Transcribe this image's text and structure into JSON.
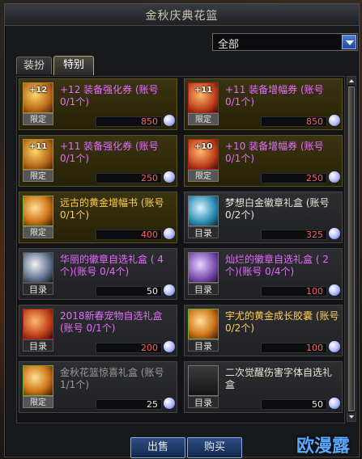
{
  "window": {
    "title": "金秋庆典花篮"
  },
  "filter": {
    "selected": "全部"
  },
  "tabs": [
    {
      "label": "装扮"
    },
    {
      "label": "特别"
    }
  ],
  "items": [
    {
      "badge": "+12",
      "tag": "限定",
      "name": "+12 装备强化券 (账号 0/1个)",
      "price": "850",
      "icon": "enhance-ticket-icon"
    },
    {
      "badge": "+11",
      "tag": "限定",
      "name": "+11 装备增幅券 (账号 0/1个)",
      "price": "850",
      "icon": "amplify-ticket-icon"
    },
    {
      "badge": "+11",
      "tag": "限定",
      "name": "+11 装备强化券 (账号 0/1个)",
      "price": "250",
      "icon": "enhance-ticket-icon"
    },
    {
      "badge": "+10",
      "tag": "限定",
      "name": "+10 装备增幅券 (账号 0/1个)",
      "price": "250",
      "icon": "amplify-ticket-icon"
    },
    {
      "badge": "",
      "tag": "限定",
      "name": "远古的黄金增幅书 (账号 0/1个)",
      "price": "400",
      "icon": "gold-book-icon"
    },
    {
      "badge": "",
      "tag": "目录",
      "name": "梦想白金徽章礼盒 (账号 0/2个)",
      "price": "325",
      "icon": "platinum-emblem-box-icon"
    },
    {
      "badge": "",
      "tag": "目录",
      "name": "华丽的徽章自选礼盒 ( 4个)(账号 0/4个)",
      "price": "50",
      "icon": "emblem-box-icon"
    },
    {
      "badge": "",
      "tag": "目录",
      "name": "灿烂的徽章自选礼盒 ( 2个)(账号 0/4个)",
      "price": "100",
      "icon": "emblem-box-icon"
    },
    {
      "badge": "",
      "tag": "目录",
      "name": "2018新春宠物自选礼盒 (账号 0/1个)",
      "price": "200",
      "icon": "pet-box-icon"
    },
    {
      "badge": "",
      "tag": "目录",
      "name": "宇尤的黄金成长胶囊 (账号 0/2个)",
      "price": "100",
      "icon": "growth-capsule-icon"
    },
    {
      "badge": "",
      "tag": "限定",
      "name": "金秋花篮惊喜礼盒 (账号 1/1个)",
      "price": "25",
      "icon": "surprise-box-icon"
    },
    {
      "badge": "",
      "tag": "目录",
      "name": "二次觉醒伤害字体自选礼盒",
      "price": "50",
      "icon": "font-box-icon"
    }
  ],
  "buttons": {
    "sell": "出售",
    "buy": "购买"
  },
  "watermark": "欧漫露"
}
